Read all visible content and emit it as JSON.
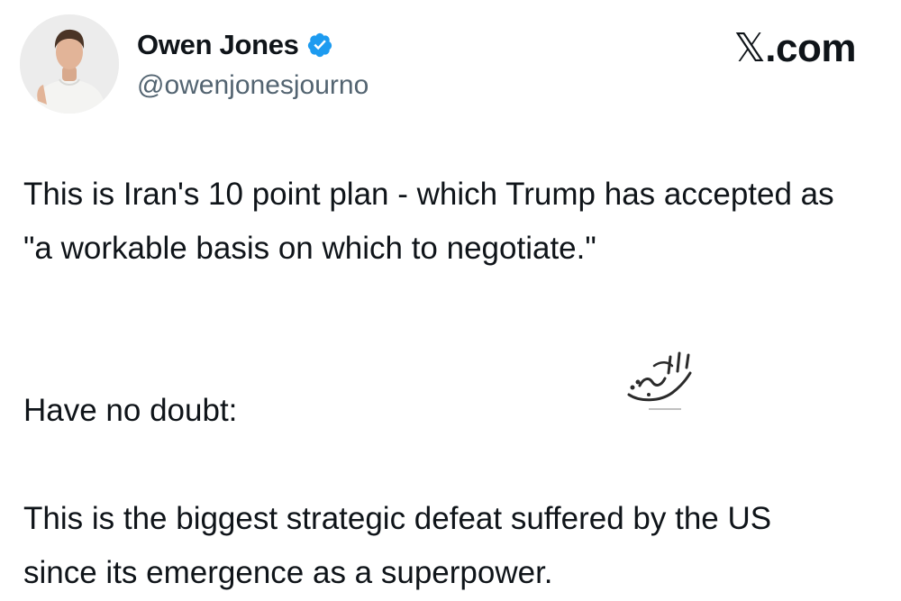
{
  "author": {
    "display_name": "Owen Jones",
    "handle": "@owenjonesjourno",
    "verified_icon": "verified-badge-icon",
    "verified_color": "#1d9bf0"
  },
  "brand": {
    "label": "X.com"
  },
  "tweet": {
    "paragraphs": [
      "This is Iran's 10 point plan - which Trump has accepted as \"a workable basis on which to negotiate.\"",
      "Have no doubt:",
      "This is the biggest strategic defeat suffered by the US since its emergence as a superpower."
    ]
  },
  "watermark": {
    "text": "جهان‌مدار"
  },
  "colors": {
    "text": "#0f1419",
    "secondary_text": "#536471",
    "background": "#ffffff"
  }
}
